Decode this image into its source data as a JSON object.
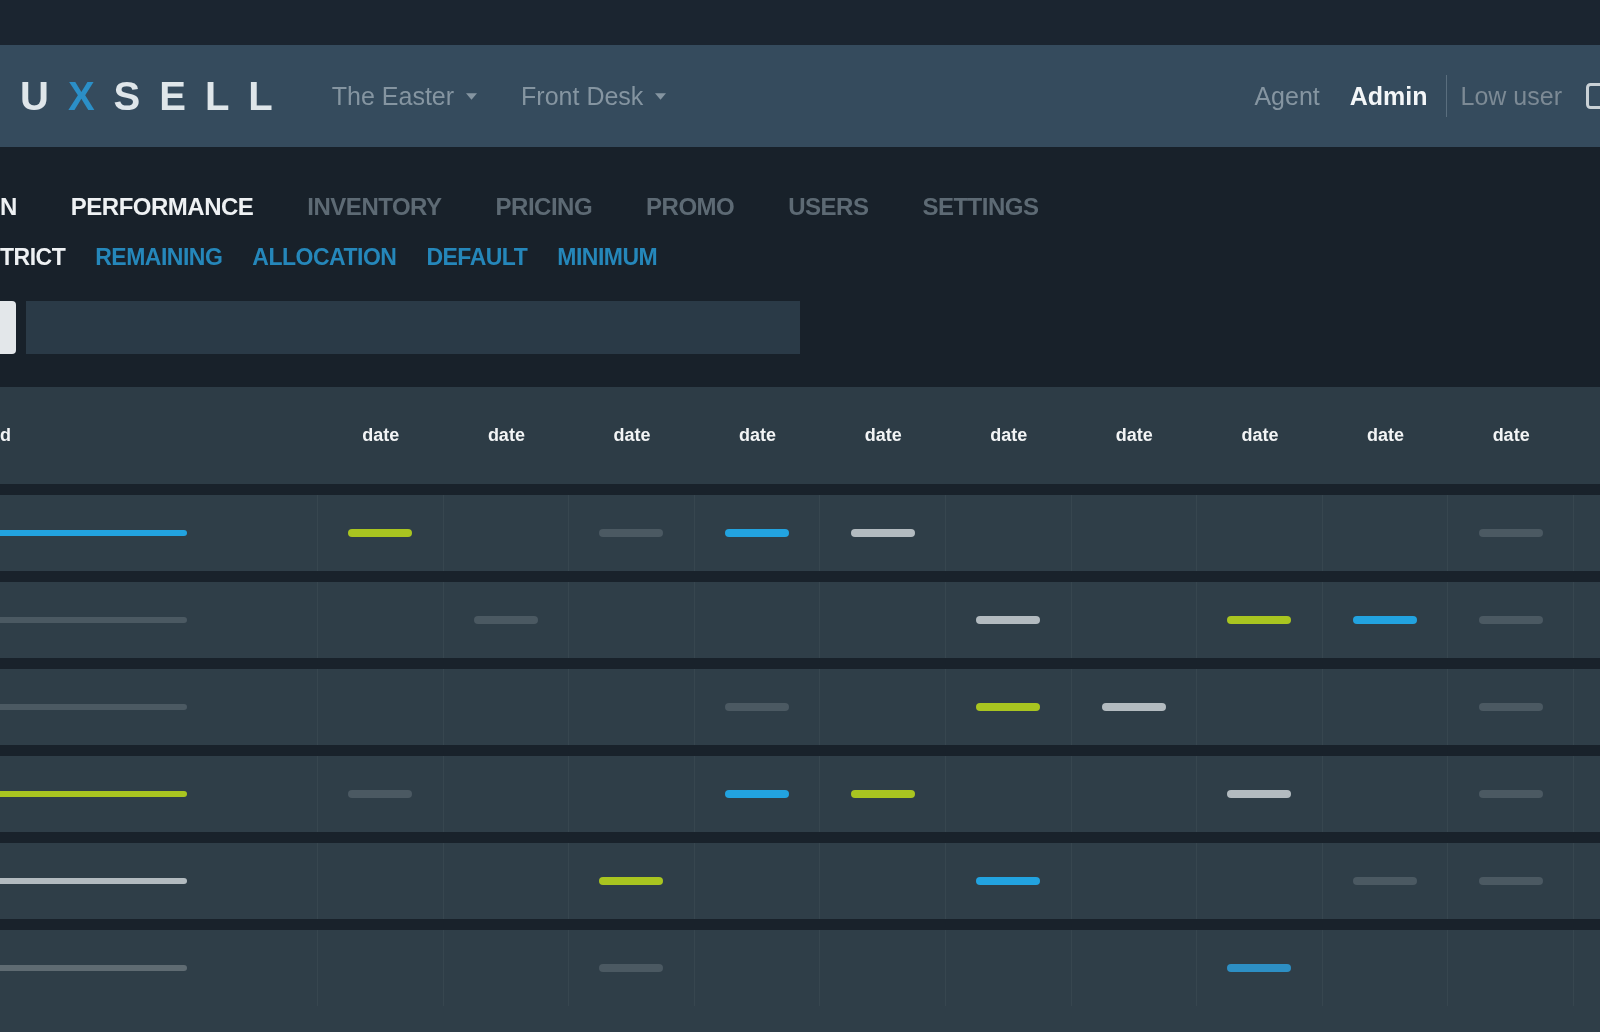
{
  "header": {
    "logo": [
      {
        "text": "U",
        "accent": false
      },
      {
        "text": "X",
        "accent": true
      },
      {
        "text": "SELL",
        "accent": false
      }
    ],
    "dropdowns": [
      {
        "label": "The Easter"
      },
      {
        "label": "Front Desk"
      }
    ],
    "roles": [
      {
        "label": "Agent",
        "selected": false
      },
      {
        "label": "Admin",
        "selected": true
      }
    ],
    "user": "Low user"
  },
  "nav": {
    "tabs": [
      {
        "label": "N",
        "selected": true
      },
      {
        "label": "PERFORMANCE",
        "selected": true
      },
      {
        "label": "INVENTORY",
        "selected": false
      },
      {
        "label": "PRICING",
        "selected": false
      },
      {
        "label": "PROMO",
        "selected": false
      },
      {
        "label": "USERS",
        "selected": false
      },
      {
        "label": "SETTINGS",
        "selected": false
      }
    ]
  },
  "subnav": {
    "tabs": [
      {
        "label": "TRICT",
        "selected": true
      },
      {
        "label": "REMAINING",
        "selected": false
      },
      {
        "label": "ALLOCATION",
        "selected": false
      },
      {
        "label": "DEFAULT",
        "selected": false
      },
      {
        "label": "MINIMUM",
        "selected": false
      }
    ]
  },
  "table": {
    "columns": [
      "d",
      "date",
      "date",
      "date",
      "date",
      "date",
      "date",
      "date",
      "date",
      "date",
      "date"
    ],
    "rows": [
      {
        "bar": {
          "color": "#22a3e0"
        },
        "cells": [
          {
            "kind": "bar",
            "color": "#a9c520"
          },
          {
            "kind": "empty"
          },
          {
            "kind": "bar",
            "color": "#4b5962"
          },
          {
            "kind": "bar",
            "color": "#22a3e0"
          },
          {
            "kind": "bar",
            "color": "#b3bbc0"
          },
          {
            "kind": "empty"
          },
          {
            "kind": "empty"
          },
          {
            "kind": "empty"
          },
          {
            "kind": "empty"
          },
          {
            "kind": "bar",
            "color": "#4b5962"
          }
        ]
      },
      {
        "bar": {
          "color": "#4b5962"
        },
        "cells": [
          {
            "kind": "empty"
          },
          {
            "kind": "bar",
            "color": "#4b5962"
          },
          {
            "kind": "empty"
          },
          {
            "kind": "empty"
          },
          {
            "kind": "empty"
          },
          {
            "kind": "bar",
            "color": "#b3bbc0"
          },
          {
            "kind": "empty"
          },
          {
            "kind": "bar",
            "color": "#a9c520"
          },
          {
            "kind": "bar",
            "color": "#22a3e0"
          },
          {
            "kind": "bar",
            "color": "#4b5962"
          }
        ]
      },
      {
        "bar": {
          "color": "#4b5962"
        },
        "cells": [
          {
            "kind": "empty"
          },
          {
            "kind": "empty"
          },
          {
            "kind": "empty"
          },
          {
            "kind": "bar",
            "color": "#4b5962"
          },
          {
            "kind": "empty"
          },
          {
            "kind": "bar",
            "color": "#a9c520"
          },
          {
            "kind": "bar",
            "color": "#b3bbc0"
          },
          {
            "kind": "empty"
          },
          {
            "kind": "empty"
          },
          {
            "kind": "bar",
            "color": "#4b5962"
          }
        ]
      },
      {
        "bar": {
          "color": "#a9c520"
        },
        "cells": [
          {
            "kind": "bar",
            "color": "#4b5962"
          },
          {
            "kind": "empty"
          },
          {
            "kind": "empty"
          },
          {
            "kind": "bar",
            "color": "#22a3e0"
          },
          {
            "kind": "bar",
            "color": "#a9c520"
          },
          {
            "kind": "empty"
          },
          {
            "kind": "empty"
          },
          {
            "kind": "bar",
            "color": "#b3bbc0"
          },
          {
            "kind": "empty"
          },
          {
            "kind": "bar",
            "color": "#4b5962"
          }
        ]
      },
      {
        "bar": {
          "color": "#b3bbc0"
        },
        "cells": [
          {
            "kind": "empty"
          },
          {
            "kind": "empty"
          },
          {
            "kind": "bar",
            "color": "#a9c520"
          },
          {
            "kind": "empty"
          },
          {
            "kind": "empty"
          },
          {
            "kind": "bar",
            "color": "#22a3e0"
          },
          {
            "kind": "empty"
          },
          {
            "kind": "empty"
          },
          {
            "kind": "bar",
            "color": "#4b5962"
          },
          {
            "kind": "bar",
            "color": "#4b5962"
          }
        ]
      },
      {
        "bar": {
          "color": "#5f6b72"
        },
        "cells": [
          {
            "kind": "empty"
          },
          {
            "kind": "empty"
          },
          {
            "kind": "bar",
            "color": "#4b5962"
          },
          {
            "kind": "empty"
          },
          {
            "kind": "empty"
          },
          {
            "kind": "empty"
          },
          {
            "kind": "empty"
          },
          {
            "kind": "bar",
            "color": "#2d8fc4"
          },
          {
            "kind": "empty"
          },
          {
            "kind": "empty"
          }
        ]
      }
    ]
  }
}
